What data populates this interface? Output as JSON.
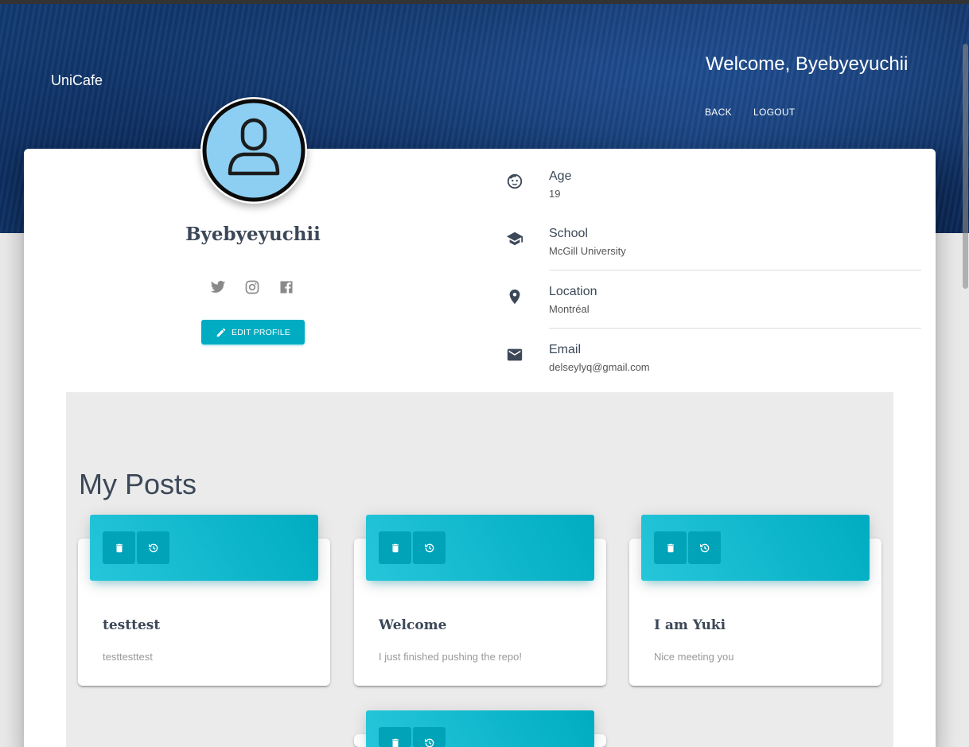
{
  "header": {
    "brand": "UniCafe",
    "welcome": "Welcome, Byebyeyuchii",
    "nav": {
      "back": "BACK",
      "logout": "LOGOUT"
    }
  },
  "profile": {
    "username": "Byebyeyuchii",
    "edit_label": "EDIT PROFILE",
    "socials": [
      "twitter-icon",
      "instagram-icon",
      "facebook-icon"
    ]
  },
  "info": {
    "age": {
      "label": "Age",
      "value": "19"
    },
    "school": {
      "label": "School",
      "value": "McGill University"
    },
    "location": {
      "label": "Location",
      "value": "Montréal"
    },
    "email": {
      "label": "Email",
      "value": "delseylyq@gmail.com"
    }
  },
  "posts": {
    "title": "My Posts",
    "items": [
      {
        "title": "testtest",
        "body": "testtesttest"
      },
      {
        "title": "Welcome",
        "body": "I just finished pushing the repo!"
      },
      {
        "title": "I am Yuki",
        "body": "Nice meeting you"
      },
      {
        "title": "",
        "body": ""
      }
    ]
  },
  "colors": {
    "accent": "#00acc1",
    "hero": "#123a72",
    "avatar_bg": "#8dcff2"
  }
}
